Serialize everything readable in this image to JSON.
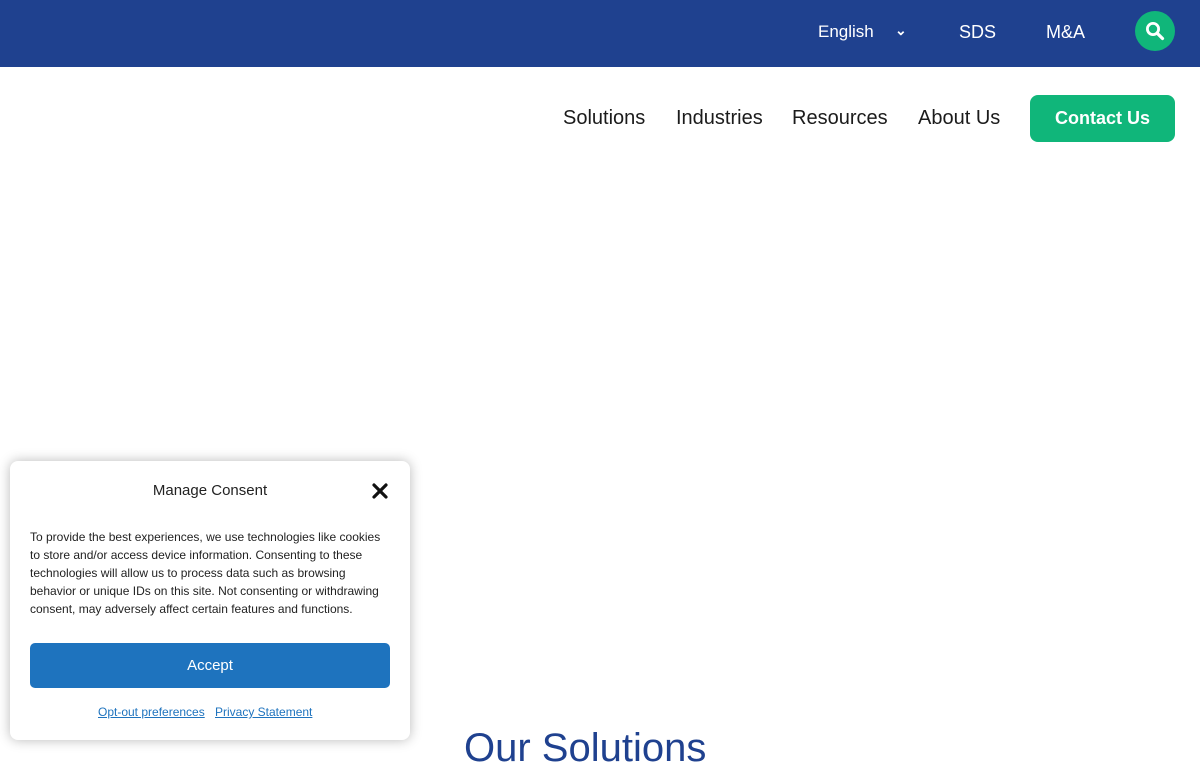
{
  "topbar": {
    "language": "English",
    "links": [
      "SDS",
      "M&A"
    ],
    "search_icon": "search-icon",
    "bg_color": "#1f418f"
  },
  "nav": {
    "items": [
      "Solutions",
      "Industries",
      "Resources",
      "About Us"
    ],
    "contact_label": "Contact Us",
    "accent_color": "#10b67a"
  },
  "main": {
    "section_title": "Our Solutions"
  },
  "consent": {
    "title": "Manage Consent",
    "close_icon": "close-icon",
    "body": "To provide the best experiences, we use technologies like cookies to store and/or access device information. Consenting to these technologies will allow us to process data such as browsing behavior or unique IDs on this site. Not consenting or withdrawing consent, may adversely affect certain features and functions.",
    "accept_label": "Accept",
    "opt_out_label": "Opt-out preferences",
    "privacy_label": "Privacy Statement",
    "button_color": "#1e73be"
  }
}
